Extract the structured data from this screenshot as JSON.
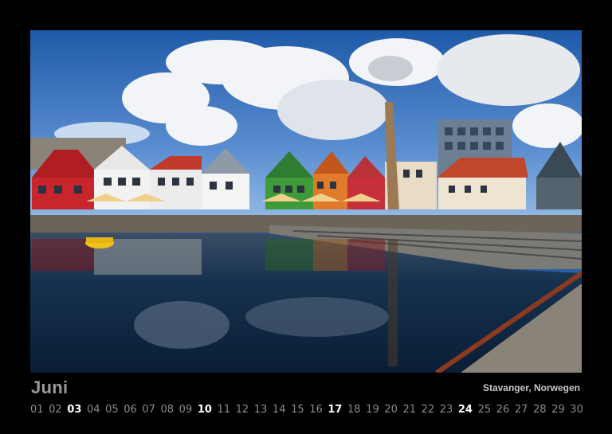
{
  "calendar": {
    "month": "Juni",
    "caption": "Stavanger, Norwegen",
    "days": [
      "01",
      "02",
      "03",
      "04",
      "05",
      "06",
      "07",
      "08",
      "09",
      "10",
      "11",
      "12",
      "13",
      "14",
      "15",
      "16",
      "17",
      "18",
      "19",
      "20",
      "21",
      "22",
      "23",
      "24",
      "25",
      "26",
      "27",
      "28",
      "29",
      "30"
    ],
    "highlighted_days": [
      "03",
      "10",
      "17",
      "24"
    ]
  },
  "photo": {
    "subject": "harbour-with-colorful-houses",
    "colors": {
      "sky": "#2f66b3",
      "water": "#0d2744",
      "text_dim": "#9a9a9a",
      "text_bright": "#ffffff"
    }
  }
}
